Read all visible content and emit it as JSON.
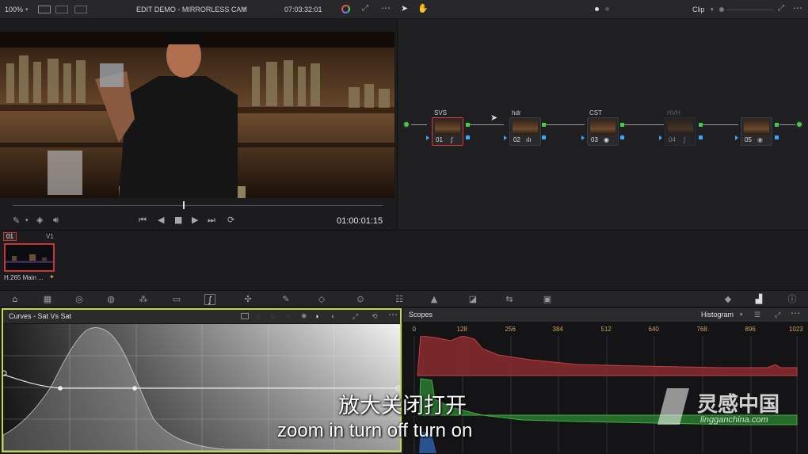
{
  "topbar": {
    "zoom": "100%",
    "title": "EDIT DEMO - MIRRORLESS CAM",
    "timecode": "07:03:32:01",
    "mode": "Clip"
  },
  "viewer": {
    "timecode": "01:00:01:15",
    "playhead_fraction": 0.46
  },
  "nodes": [
    {
      "label": "SVS",
      "num": "01",
      "active": true,
      "dim": false
    },
    {
      "label": "hdr",
      "num": "02",
      "active": false,
      "dim": false
    },
    {
      "label": "CST",
      "num": "03",
      "active": false,
      "dim": false
    },
    {
      "label": "HVH",
      "num": "04",
      "active": false,
      "dim": true
    },
    {
      "label": "",
      "num": "05",
      "active": false,
      "dim": false
    }
  ],
  "timeline": {
    "clip_index": "01",
    "track": "V1",
    "clip_name": "H.265 Main ..."
  },
  "curves": {
    "title": "Curves - Sat Vs Sat"
  },
  "scopes": {
    "title": "Scopes",
    "mode": "Histogram",
    "ticks": [
      "0",
      "128",
      "256",
      "384",
      "512",
      "640",
      "768",
      "896",
      "1023"
    ]
  },
  "subtitle": {
    "zh": "放大关闭打开",
    "en": "zoom in turn off turn on"
  },
  "watermark": {
    "name": "灵感中国",
    "url": "lingganchina.com"
  },
  "icons": [
    "dropper-icon",
    "layers-icon",
    "volume-icon",
    "skip-start-icon",
    "step-back-icon",
    "stop-icon",
    "play-icon",
    "skip-end-icon",
    "loop-icon",
    "pointer-icon",
    "hand-icon",
    "reset-icon",
    "more-icon"
  ]
}
